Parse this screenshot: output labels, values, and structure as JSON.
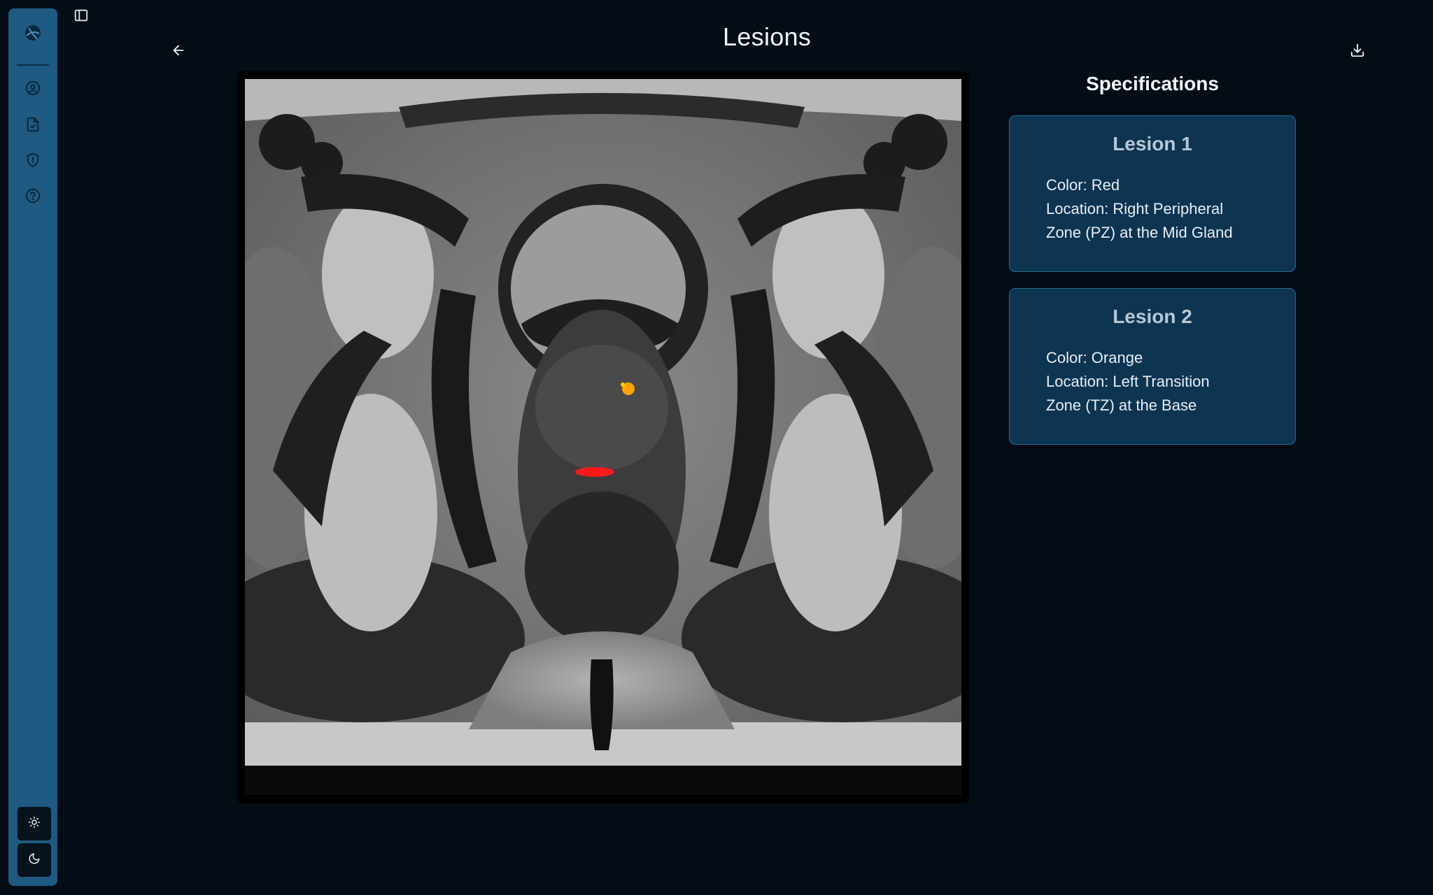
{
  "page": {
    "title": "Lesions"
  },
  "sidebar": {
    "logo_icon": "globe-logo",
    "items": [
      {
        "name": "profile",
        "icon": "user-circle-icon"
      },
      {
        "name": "reports",
        "icon": "file-check-icon"
      },
      {
        "name": "privacy",
        "icon": "shield-icon"
      },
      {
        "name": "help",
        "icon": "help-circle-icon"
      }
    ],
    "theme": [
      {
        "name": "light",
        "icon": "sun-icon"
      },
      {
        "name": "dark",
        "icon": "moon-icon"
      }
    ],
    "accent": "#1e5a82"
  },
  "specifications": {
    "heading": "Specifications",
    "lesions": [
      {
        "title": "Lesion 1",
        "color_line": "Color: Red",
        "location_line1": "Location: Right Peripheral",
        "location_line2": "Zone (PZ) at the Mid Gland",
        "marker_color": "#ff1a1a"
      },
      {
        "title": "Lesion 2",
        "color_line": "Color: Orange",
        "location_line1": "Location: Left Transition",
        "location_line2": "Zone (TZ) at the Base",
        "marker_color": "#ffa500"
      }
    ]
  },
  "colors": {
    "background": "#040d15",
    "card": "#0d3552",
    "card_border": "#2a6a93"
  }
}
